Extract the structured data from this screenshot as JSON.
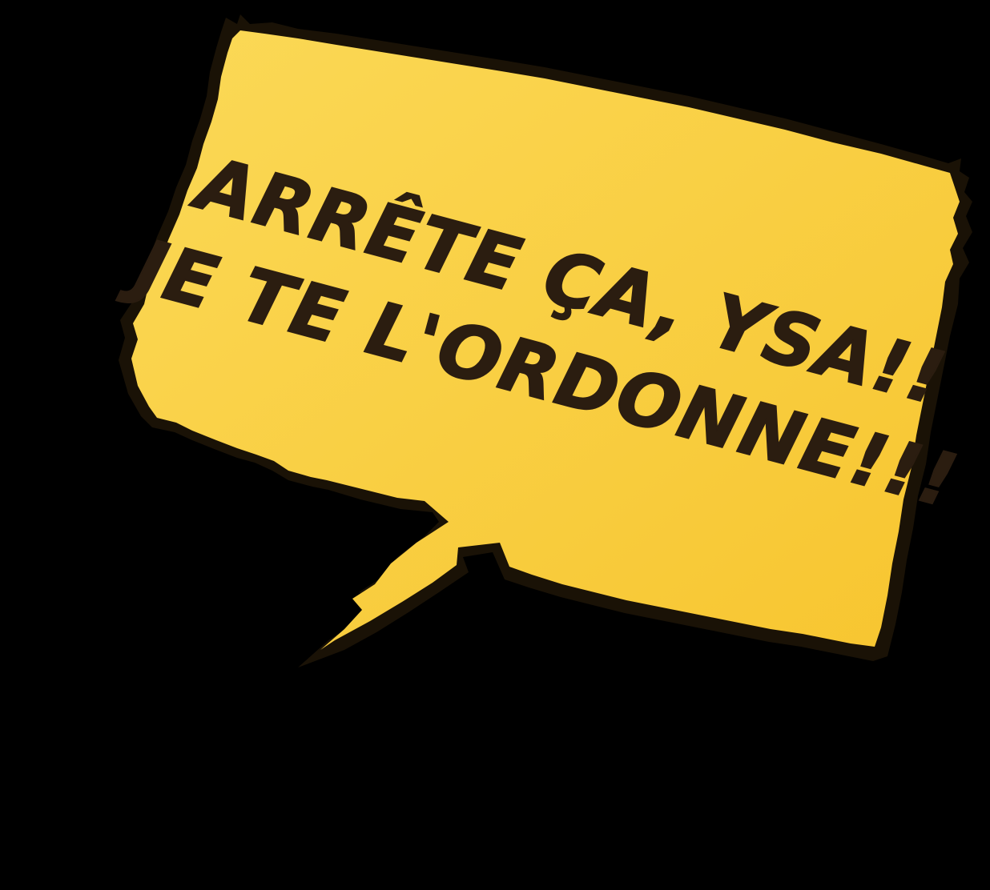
{
  "speech_bubble": {
    "line1": "ARRÊTE ÇA, YSA!!",
    "line2": "JE TE L'ORDONNE!!!"
  },
  "colors": {
    "background": "#000000",
    "bubble_fill": "#F9CC37",
    "bubble_fill_light": "#FBD957",
    "bubble_outline": "#1A1206",
    "text": "#2B1D10"
  }
}
